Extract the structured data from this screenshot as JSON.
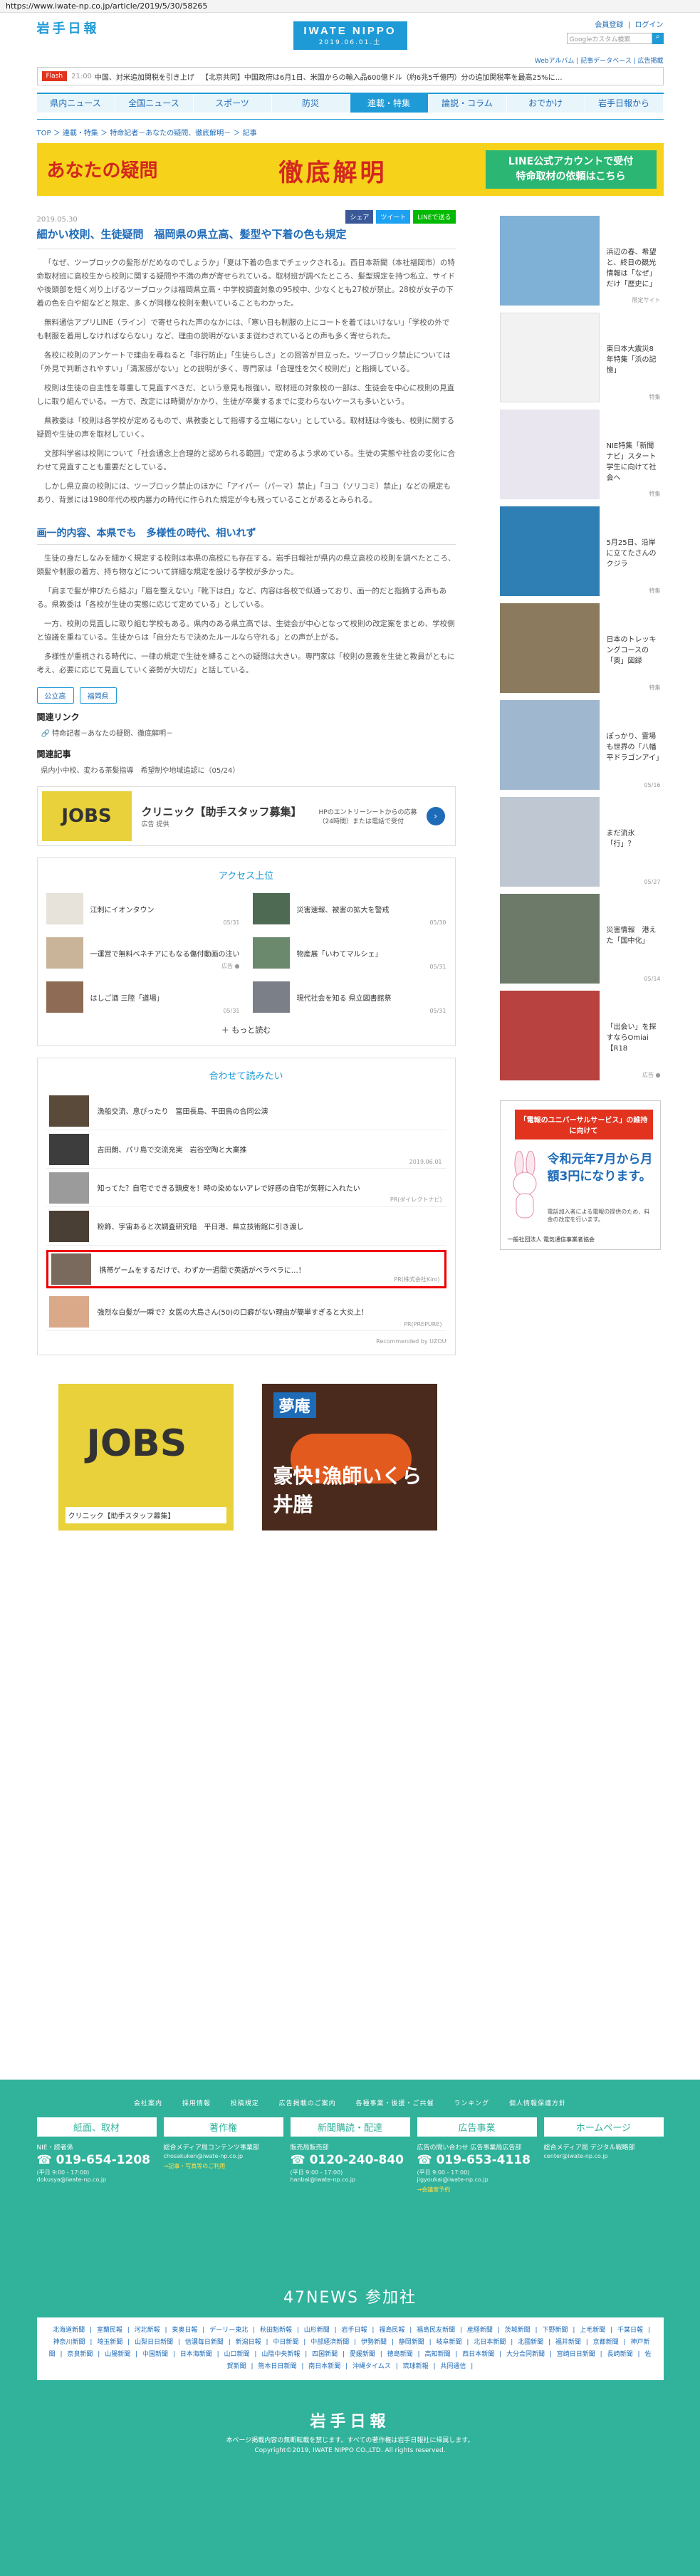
{
  "browser": {
    "url": "https://www.iwate-np.co.jp/article/2019/5/30/58265"
  },
  "header": {
    "logo_left": "岩手日報",
    "logo_center": "IWATE NIPPO",
    "logo_date": "2019.06.01.土",
    "register": "会員登録",
    "login": "ログイン",
    "search_placeholder": "Googleカスタム検索",
    "search_icon": "magnifier",
    "links": [
      "Webアルバム",
      "記事データベース",
      "広告掲載"
    ]
  },
  "ticker": {
    "flash": "Flash",
    "items": [
      {
        "time": "21:00",
        "text": "中国、対米追加関税を引き上げ"
      },
      {
        "time": "",
        "text": "【北京共同】中国政府は6月1日、米国からの輸入品600億ドル（約6兆5千億円）分の追加関税率を最高25%に…"
      }
    ]
  },
  "nav": {
    "items": [
      "県内ニュース",
      "全国ニュース",
      "スポーツ",
      "防災",
      "連載・特集",
      "論説・コラム",
      "おでかけ",
      "岩手日報から"
    ],
    "active_index": 4
  },
  "breadcrumb": [
    "TOP",
    "連載・特集",
    "特命記者－あなたの疑問、徹底解明－",
    "記事"
  ],
  "banner": {
    "left": "あなたの疑問",
    "center": "徹底解明",
    "right_line1": "LINE公式アカウントで受付",
    "right_line2": "特命取材の依頼はこちら"
  },
  "article": {
    "date": "2019.05.30",
    "title": "細かい校則、生徒疑問　福岡県の県立高、髪型や下着の色も規定",
    "share": {
      "facebook": "シェア",
      "twitter": "ツイート",
      "line": "LINEで送る"
    },
    "paragraphs": [
      "「なぜ、ツーブロックの髪形がだめなのでしょうか」「夏は下着の色までチェックされる」。西日本新聞（本社福岡市）の特命取材班に高校生から校則に関する疑問や不満の声が寄せられている。取材班が調べたところ、髪型規定を持つ私立、サイドや後頭部を短く刈り上げるツーブロックは福岡県立高・中学校調査対象の95校中、少なくとも27校が禁止。28校が女子の下着の色を白や紺などと限定、多くが同様な校則を敷いていることもわかった。",
      "無料通信アプリLINE（ライン）で寄せられた声のなかには、「寒い日も制服の上にコートを着てはいけない」「学校の外でも制服を着用しなければならない」など、理由の説明がないまま従わされているとの声も多く寄せられた。",
      "各校に校則のアンケートで理由を尋ねると「非行防止」「生徒らしさ」との回答が目立った。ツーブロック禁止については「外見で判断されやすい」「清潔感がない」との説明が多く、専門家は「合理性を欠く校則だ」と指摘している。",
      "校則は生徒の自主性を尊重して見直すべきだ、という意見も根強い。取材班の対象校の一部は、生徒会を中心に校則の見直しに取り組んでいる。一方で、改定には時間がかかり、生徒が卒業するまでに変わらないケースも多いという。",
      "県教委は「校則は各学校が定めるもので、県教委として指導する立場にない」としている。取材班は今後も、校則に関する疑問や生徒の声を取材していく。",
      "文部科学省は校則について「社会通念上合理的と認められる範囲」で定めるよう求めている。生徒の実態や社会の変化に合わせて見直すことも重要だとしている。",
      "しかし県立高の校則には、ツーブロック禁止のほかに「アイパー（パーマ）禁止」「ヨコ（ソリコミ）禁止」などの規定もあり、背景には1980年代の校内暴力の時代に作られた規定が今も残っていることがあるとみられる。"
    ],
    "subhead": "画一的内容、本県でも　多様性の時代、相いれず",
    "paragraphs2": [
      "生徒の身だしなみを細かく規定する校則は本県の高校にも存在する。岩手日報社が県内の県立高校の校則を調べたところ、頭髪や制服の着方、持ち物などについて詳細な規定を設ける学校が多かった。",
      "「肩まで髪が伸びたら結ぶ」「眉を整えない」「靴下は白」など、内容は各校で似通っており、画一的だと指摘する声もある。県教委は「各校が生徒の実態に応じて定めている」としている。",
      "一方、校則の見直しに取り組む学校もある。県内のある県立高では、生徒会が中心となって校則の改定案をまとめ、学校側と協議を重ねている。生徒からは「自分たちで決めたルールなら守れる」との声が上がる。",
      "多様性が重視される時代に、一律の規定で生徒を縛ることへの疑問は大きい。専門家は「校則の意義を生徒と教員がともに考え、必要に応じて見直していく姿勢が大切だ」と話している。"
    ],
    "tags": [
      "公立高",
      "福岡県"
    ],
    "related_links_heading": "関連リンク",
    "related_link": "特命記者－あなたの疑問、徹底解明－",
    "related_articles_heading": "関連記事",
    "related_article": "県内小中校、変わる茶髪指導　希望制や地域追認に（05/24）"
  },
  "ad_strip": {
    "logo": "JOBS",
    "title": "クリニック【助手スタッフ募集】",
    "sub": "広告 提供",
    "mid": "HPのエントリーシートからの応募（24時間）または電話で受付"
  },
  "access_ranking": {
    "heading": "アクセス上位",
    "items": [
      {
        "title": "江刺にイオンタウン",
        "date": "05/31"
      },
      {
        "title": "災害速報、被害の拡大を警戒",
        "date": "05/30"
      },
      {
        "title": "一運営で無料ベネチアにもなる傷付動画の注い",
        "date": "広告 ●"
      },
      {
        "title": "物産展「いわてマルシェ」",
        "date": "05/31"
      },
      {
        "title": "はしご酒 三陸「道場」",
        "date": "05/31"
      },
      {
        "title": "現代社会を知る 県立図書館祭",
        "date": "05/31"
      }
    ],
    "more": "もっと読む"
  },
  "recommend": {
    "heading": "合わせて読みたい",
    "items": [
      {
        "title": "漁船交流、息ぴったり　富田長島、平田鳥の合同公演",
        "source": ""
      },
      {
        "title": "吉田朗、パリ島で交流充実　岩谷空陶と大業推",
        "source": "2019.06.01"
      },
      {
        "title": "知ってた？自宅でできる頭皮を！時の染めないアレで好感の自宅が気軽に入れたい",
        "source": "PR(ダイレクトナビ)"
      },
      {
        "title": "粉飾、宇宙あると次調査研究暗　平日港、県立技術館に引き渡し",
        "source": ""
      },
      {
        "title": "携帯ゲームをするだけで、わずか一週間で英語がペラペラに…！",
        "source": "PR(株式会社Kiro)",
        "highlight": true
      },
      {
        "title": "強烈な白髪が一瞬で？女医の大島さん(50)の口癖がない理由が簡単すぎると大炎上！",
        "source": "PR(PREPURE)"
      }
    ],
    "footer": "Recommended by UZOU"
  },
  "bottom_ads": [
    {
      "logo": "JOBS",
      "text": "クリニック【助手スタッフ募集】"
    },
    {
      "title": "夢庵",
      "text": "豪快!漁師いくら丼膳"
    }
  ],
  "sidebar": {
    "cards": [
      {
        "title": "浜辺の春、希望と、終日の観光情報は「なぜ」だけ「歴史に」",
        "note": "限定サイト"
      },
      {
        "title": "東日本大震災8年特集「浜の記憶」",
        "note": "特集"
      },
      {
        "title": "NIE特集「新聞ナビ」スタート　学生に向けて社会へ",
        "note": "特集"
      },
      {
        "title": "5月25日、沿岸に立てたさんのクジラ",
        "note": "特集"
      },
      {
        "title": "日本のトレッキングコースの「奥」図録",
        "note": "特集"
      },
      {
        "title": "ぽっかり、霊場も世界の「八幡平ドラゴンアイ」",
        "note": "05/16"
      },
      {
        "title": "まだ流氷「行」？",
        "note": "05/27"
      },
      {
        "title": "災害情報　港えた「国中化」",
        "note": "05/14"
      },
      {
        "title": "「出会い」を探すならOmiai 【R18",
        "note": "広告 ●"
      }
    ],
    "ad": {
      "top": "「電報のユニバーサルサービス」の維持に向けて",
      "main": "令和元年7月から月額3円になります。",
      "sub": "電話加入者による電報の提供のため、料金の改定を行います。",
      "org": "一般社団法人 電気通信事業者協会"
    }
  },
  "footer": {
    "links": [
      "会社案内",
      "採用情報",
      "投稿規定",
      "広告掲載のご案内",
      "各種事業・後援・ご共催",
      "ランキング",
      "個人情報保護方針"
    ],
    "cols": [
      {
        "head": "紙面、取材",
        "sub": "NIE・読者係",
        "tel": "019-654-1208",
        "note": "(平日 9:00 - 17:00)",
        "email": "dokusya@iwate-np.co.jp",
        "extra": ""
      },
      {
        "head": "著作権",
        "sub": "総合メディア局コンテンツ事業部",
        "tel": "",
        "note": "",
        "email": "chosakuken@iwate-np.co.jp",
        "extra": "→記事・写真等のご利用"
      },
      {
        "head": "新聞購読・配達",
        "sub": "販売局販売部",
        "tel": "0120-240-840",
        "note": "(平日 9:00 - 17:00)",
        "email": "hanbai@iwate-np.co.jp",
        "extra": ""
      },
      {
        "head": "広告事業",
        "sub": "広告の問い合わせ 広告事業局広告部",
        "tel": "019-653-4118",
        "note": "(平日 9:00 - 17:00)",
        "email": "jigyoukai@iwate-np.co.jp",
        "extra": "→会議室予約"
      },
      {
        "head": "ホームページ",
        "sub": "総合メディア局 デジタル戦略部",
        "tel": "",
        "note": "",
        "email": "center@iwate-np.co.jp",
        "extra": ""
      }
    ],
    "n47": "47NEWS 参加社",
    "papers": [
      "北海道新聞",
      "室蘭民報",
      "河北新報",
      "東奥日報",
      "デーリー東北",
      "秋田魁新報",
      "山形新聞",
      "岩手日報",
      "福島民報",
      "福島民友新聞",
      "産経新聞",
      "茨城新聞",
      "下野新聞",
      "上毛新聞",
      "千葉日報",
      "神奈川新聞",
      "埼玉新聞",
      "山梨日日新聞",
      "信濃毎日新聞",
      "新潟日報",
      "中日新聞",
      "中部経済新聞",
      "伊勢新聞",
      "静岡新聞",
      "岐阜新聞",
      "北日本新聞",
      "北國新聞",
      "福井新聞",
      "京都新聞",
      "神戸新聞",
      "奈良新聞",
      "山陽新聞",
      "中国新聞",
      "日本海新聞",
      "山口新聞",
      "山陰中央新報",
      "四国新聞",
      "愛媛新聞",
      "徳島新聞",
      "高知新聞",
      "西日本新聞",
      "大分合同新聞",
      "宮崎日日新聞",
      "長崎新聞",
      "佐賀新聞",
      "熊本日日新聞",
      "南日本新聞",
      "沖縄タイムス",
      "琉球新報",
      "共同通信"
    ],
    "logo": "岩手日報",
    "copy1": "本ページ掲載内容の無断転載を禁じます。すべての著作権は岩手日報社に帰属します。",
    "copy2": "Copyright©2019, IWATE NIPPO CO.,LTD. All rights reserved."
  }
}
